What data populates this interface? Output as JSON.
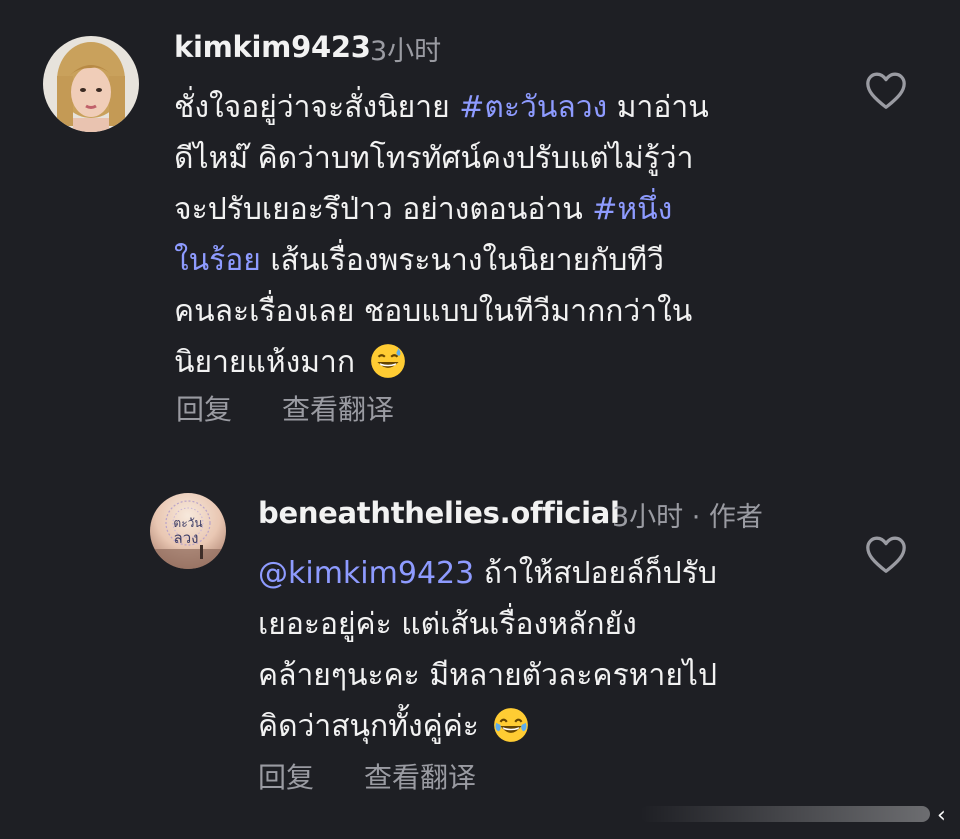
{
  "comments": [
    {
      "username": "kimkim9423",
      "time": "3小时",
      "lines": [
        [
          {
            "t": "ชั่งใจอยู่ว่าจะสั่งนิยาย "
          },
          {
            "t": "#ตะวันลวง",
            "tag": true
          },
          {
            "t": " มาอ่าน"
          }
        ],
        [
          {
            "t": "ดีไหม๊ คิดว่าบทโทรทัศน์คงปรับแต่ไม่รู้ว่า"
          }
        ],
        [
          {
            "t": "จะปรับเยอะรึป่าว อย่างตอนอ่าน "
          },
          {
            "t": "#หนึ่ง",
            "tag": true
          }
        ],
        [
          {
            "t": "ในร้อย",
            "tag": true
          },
          {
            "t": " เส้นเรื่องพระนางในนิยายกับทีวี"
          }
        ],
        [
          {
            "t": "คนละเรื่องเลย ชอบแบบในทีวีมากกว่าใน"
          }
        ],
        [
          {
            "t": "นิยายแห้งมาก "
          },
          {
            "emoji": "sweat-smile-emoji"
          }
        ]
      ],
      "reply_label": "回复",
      "translate_label": "查看翻译",
      "like_icon": "heart-outline-icon"
    },
    {
      "username": "beneaththelies.official",
      "time": "3小时 · 作者",
      "lines": [
        [
          {
            "t": "@kimkim9423",
            "tag": true
          },
          {
            "t": " ถ้าให้สปอยล์ก็ปรับ"
          }
        ],
        [
          {
            "t": "เยอะอยู่ค่ะ แต่เส้นเรื่องหลักยัง"
          }
        ],
        [
          {
            "t": "คล้ายๆนะคะ มีหลายตัวละครหายไป"
          }
        ],
        [
          {
            "t": "คิดว่าสนุกทั้งคู่ค่ะ "
          },
          {
            "emoji": "tears-of-joy-emoji"
          }
        ]
      ],
      "reply_label": "回复",
      "translate_label": "查看翻译",
      "like_icon": "heart-outline-icon"
    }
  ],
  "colors": {
    "background": "#1e1f24",
    "text": "#f2f2f2",
    "secondary": "#9a9ba2",
    "link": "#8e9bff"
  }
}
